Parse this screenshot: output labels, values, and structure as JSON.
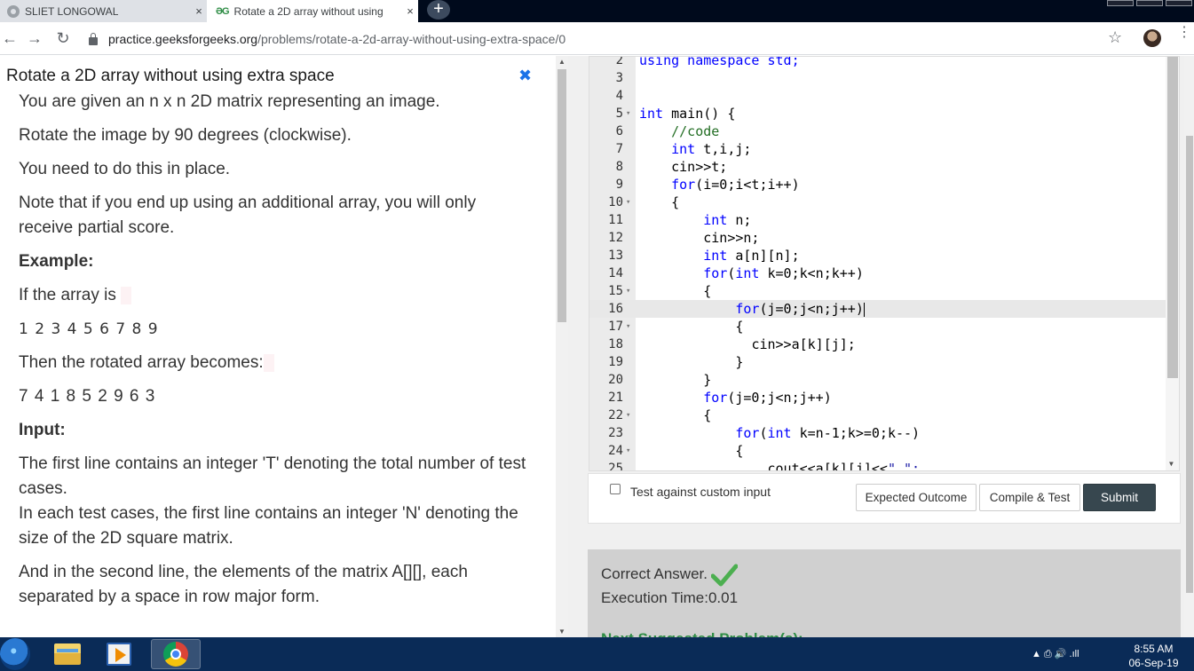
{
  "browser": {
    "tabs": [
      {
        "label": "SLIET LONGOWAL",
        "close": "×"
      },
      {
        "favicon_text": "ƏG",
        "label": "Rotate a 2D array without using",
        "close": "×"
      }
    ],
    "new_tab": "+",
    "nav": {
      "back": "←",
      "forward": "→",
      "reload": "↻"
    },
    "url_host": "practice.geeksforgeeks.org",
    "url_path": "/problems/rotate-a-2d-array-without-using-extra-space/0",
    "star": "☆",
    "menu": "⋮"
  },
  "problem": {
    "title": "Rotate a 2D array without using extra space",
    "collapse_icon": "✖",
    "paragraphs": {
      "p1": "You are given an n x n 2D matrix representing an image.",
      "p2": "Rotate the image by 90 degrees (clockwise).",
      "p3": "You need to do this in place.",
      "p4": "Note that if you end up using an additional array, you will only receive partial score.",
      "example_heading": "Example:",
      "if_array": "If the array is",
      "array_values": "1 2 3 4 5 6 7 8 9",
      "then_rotated": "Then the rotated array becomes:",
      "rotated_values": "7 4 1 8 5 2 9 6 3",
      "input_heading": "Input:",
      "input_1": "The first line contains an integer 'T' denoting the total number of test cases.",
      "input_2": "In each test cases, the first line contains an integer 'N' denoting the size of the 2D square matrix.",
      "input_3": "And in the second line, the elements of the matrix A[][], each separated by a space in row major form."
    }
  },
  "editor": {
    "lines": [
      {
        "n": "2",
        "fold": false
      },
      {
        "n": "3",
        "fold": false
      },
      {
        "n": "4",
        "fold": false
      },
      {
        "n": "5",
        "fold": true
      },
      {
        "n": "6",
        "fold": false
      },
      {
        "n": "7",
        "fold": false
      },
      {
        "n": "8",
        "fold": false
      },
      {
        "n": "9",
        "fold": false
      },
      {
        "n": "10",
        "fold": true
      },
      {
        "n": "11",
        "fold": false
      },
      {
        "n": "12",
        "fold": false
      },
      {
        "n": "13",
        "fold": false
      },
      {
        "n": "14",
        "fold": false
      },
      {
        "n": "15",
        "fold": true
      },
      {
        "n": "16",
        "fold": false
      },
      {
        "n": "17",
        "fold": true
      },
      {
        "n": "18",
        "fold": false
      },
      {
        "n": "19",
        "fold": false
      },
      {
        "n": "20",
        "fold": false
      },
      {
        "n": "21",
        "fold": false
      },
      {
        "n": "22",
        "fold": true
      },
      {
        "n": "23",
        "fold": false
      },
      {
        "n": "24",
        "fold": true
      },
      {
        "n": "25",
        "fold": false
      }
    ],
    "code": {
      "l2": "using namespace std;",
      "l5_kw": "int",
      "l5_rest": " main() {",
      "l6": "//code",
      "l7_kw": "int",
      "l7_rest": " t,i,j;",
      "l8": "cin>>t;",
      "l9_kw": "for",
      "l9_rest": "(i=0;i<t;i++)",
      "l10": "{",
      "l11_kw": "int",
      "l11_rest": " n;",
      "l12": "cin>>n;",
      "l13_kw": "int",
      "l13_rest": " a[n][n];",
      "l14_kw": "for",
      "l14_kw2": "int",
      "l14_rest": " k=0;k<n;k++)",
      "l15": "{",
      "l16_kw": "for",
      "l16_rest": "(j=0;j<n;j++)",
      "l17": "{",
      "l18": "cin>>a[k][j];",
      "l19": "}",
      "l20": "}",
      "l21_kw": "for",
      "l21_rest": "(j=0;j<n;j++)",
      "l22": "{",
      "l23_kw": "for",
      "l23_kw2": "int",
      "l23_rest": " k=n-1;k>=0;k--)",
      "l24": "{",
      "l25_a": "cout<<a[k][j]<<",
      "l25_str": "\" \";"
    },
    "active_line": "16"
  },
  "actions": {
    "custom_input_label": "Test against custom input",
    "expected_outcome": "Expected Outcome",
    "compile_test": "Compile & Test",
    "submit": "Submit"
  },
  "result": {
    "status": "Correct Answer.",
    "execution_time": "Execution Time:0.01",
    "next_hint": "Next Suggested Problem(s):"
  },
  "taskbar": {
    "tray_icons": "▲  ⎙  🔊  .ıll",
    "time": "8:55 AM",
    "date": "06-Sep-19"
  },
  "colors": {
    "submit_bg": "#37474f",
    "keyword": "#0000ff",
    "comment": "#236e24",
    "check_green": "#4caf50",
    "taskbar": "#0a2b57"
  }
}
